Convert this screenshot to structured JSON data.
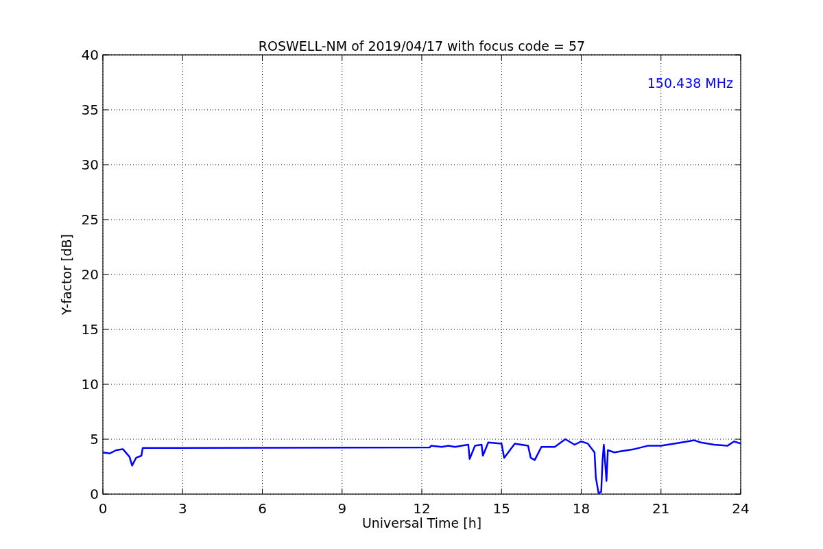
{
  "chart_data": {
    "type": "line",
    "title": "ROSWELL-NM of 2019/04/17 with focus code = 57",
    "xlabel": "Universal Time [h]",
    "ylabel": "Y-factor [dB]",
    "x": [
      0,
      0.25,
      0.5,
      0.75,
      1.0,
      1.1,
      1.25,
      1.45,
      1.5,
      12.3,
      12.35,
      12.75,
      13.0,
      13.25,
      13.5,
      13.75,
      13.8,
      14.0,
      14.25,
      14.3,
      14.5,
      15.0,
      15.1,
      15.5,
      16.0,
      16.1,
      16.25,
      16.5,
      17.0,
      17.4,
      17.75,
      18.0,
      18.25,
      18.5,
      18.55,
      18.65,
      18.75,
      18.8,
      18.85,
      18.95,
      19.0,
      19.25,
      19.5,
      19.75,
      20.0,
      20.5,
      21.0,
      21.5,
      22.0,
      22.25,
      22.5,
      23.0,
      23.5,
      23.75,
      24.0
    ],
    "series": [
      {
        "name": "150.438 MHz",
        "color": "#0000ff",
        "values": [
          3.8,
          3.7,
          4.0,
          4.1,
          3.4,
          2.6,
          3.3,
          3.5,
          4.2,
          4.25,
          4.4,
          4.3,
          4.4,
          4.3,
          4.4,
          4.5,
          3.2,
          4.4,
          4.5,
          3.5,
          4.7,
          4.6,
          3.3,
          4.6,
          4.4,
          3.3,
          3.1,
          4.3,
          4.3,
          5.0,
          4.5,
          4.8,
          4.6,
          3.8,
          1.5,
          0.1,
          0.2,
          3.0,
          4.5,
          1.2,
          4.0,
          3.8,
          3.9,
          4.0,
          4.1,
          4.4,
          4.4,
          4.6,
          4.8,
          4.9,
          4.7,
          4.5,
          4.4,
          4.8,
          4.6
        ]
      }
    ],
    "xlim": [
      0,
      24
    ],
    "ylim": [
      0,
      40
    ],
    "xticks": [
      0,
      3,
      6,
      9,
      12,
      15,
      18,
      21,
      24
    ],
    "yticks": [
      0,
      5,
      10,
      15,
      20,
      25,
      30,
      35,
      40
    ],
    "grid": true
  }
}
